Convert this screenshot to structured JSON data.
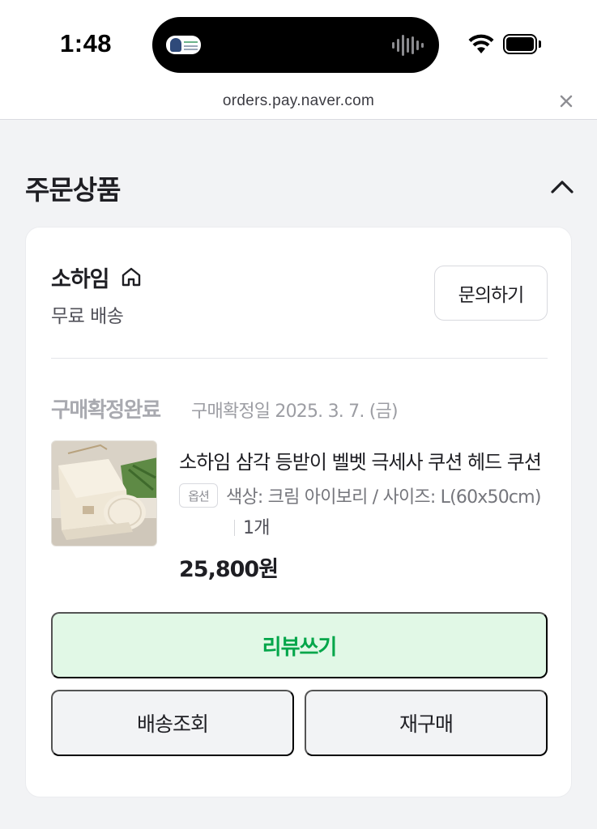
{
  "status_bar": {
    "time": "1:48"
  },
  "browser": {
    "url": "orders.pay.naver.com"
  },
  "section": {
    "title": "주문상품"
  },
  "seller": {
    "name": "소하임",
    "shipping": "무료 배송",
    "inquiry_label": "문의하기"
  },
  "order": {
    "status": "구매확정완료",
    "confirm_date": "구매확정일 2025. 3. 7. (금)",
    "product_name": "소하임 삼각 등받이 벨벳 극세사 쿠션 헤드 쿠션",
    "option_badge": "옵션",
    "option_text": "색상: 크림 아이보리 / 사이즈: L(60x50cm)",
    "quantity": "1개",
    "price": "25,800원"
  },
  "actions": {
    "review_label": "리뷰쓰기",
    "track_label": "배송조회",
    "rebuy_label": "재구매"
  },
  "colors": {
    "accent_green": "#03a64a",
    "review_bg": "#e1f8e6",
    "page_bg": "#f2f3f5"
  }
}
